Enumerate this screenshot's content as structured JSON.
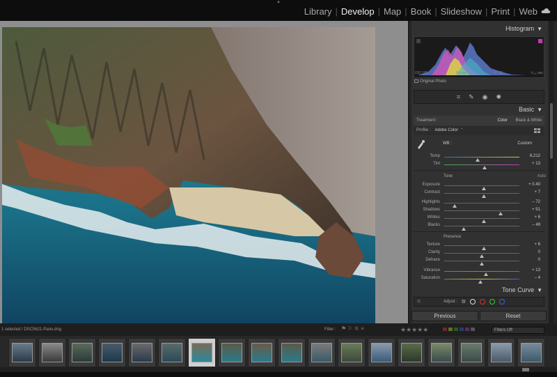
{
  "modules": [
    {
      "label": "Library",
      "active": false
    },
    {
      "label": "Develop",
      "active": true
    },
    {
      "label": "Map",
      "active": false
    },
    {
      "label": "Book",
      "active": false
    },
    {
      "label": "Slideshow",
      "active": false
    },
    {
      "label": "Print",
      "active": false
    },
    {
      "label": "Web",
      "active": false
    }
  ],
  "panels": {
    "histogram": {
      "title": "Histogram",
      "iso": "ISO 100",
      "focal": "24 mm",
      "aperture": "ƒ / 11",
      "shutter": "¹⁄₁₆₀ sec",
      "original_photo": "Original Photo"
    },
    "basic": {
      "title": "Basic",
      "treatment_label": "Treatment :",
      "treatment_color": "Color",
      "treatment_bw": "Black & White",
      "profile_label": "Profile :",
      "profile_value": "Adobe Color",
      "wb_label": "WB :",
      "wb_value": "Custom",
      "temp": {
        "label": "Temp",
        "value": "6,212"
      },
      "tint": {
        "label": "Tint",
        "value": "+ 13"
      },
      "tone_label": "Tone",
      "auto_label": "Auto",
      "exposure": {
        "label": "Exposure",
        "value": "+ 0.40"
      },
      "contrast": {
        "label": "Contrast",
        "value": "+ 7"
      },
      "highlights": {
        "label": "Highlights",
        "value": "– 72"
      },
      "shadows": {
        "label": "Shadows",
        "value": "+ 51"
      },
      "whites": {
        "label": "Whites",
        "value": "+ 6"
      },
      "blacks": {
        "label": "Blacks",
        "value": "– 49"
      },
      "presence_label": "Presence",
      "texture": {
        "label": "Texture",
        "value": "+ 6"
      },
      "clarity": {
        "label": "Clarity",
        "value": "0"
      },
      "dehaze": {
        "label": "Dehaze",
        "value": "0"
      },
      "vibrance": {
        "label": "Vibrance",
        "value": "+ 13"
      },
      "saturation": {
        "label": "Saturation",
        "value": "– 4"
      }
    },
    "tone_curve": {
      "title": "Tone Curve",
      "adjust_label": "Adjust :"
    },
    "previous_label": "Previous",
    "reset_label": "Reset"
  },
  "filmstrip": {
    "info": "1 selected / DSC5621-Pano.dng",
    "filter_label": "Filter :",
    "filters_off": "Filters Off",
    "selected_index": 6
  },
  "colors": {
    "accent_text": "#f0f0f0",
    "panel_bg": "#313131"
  }
}
